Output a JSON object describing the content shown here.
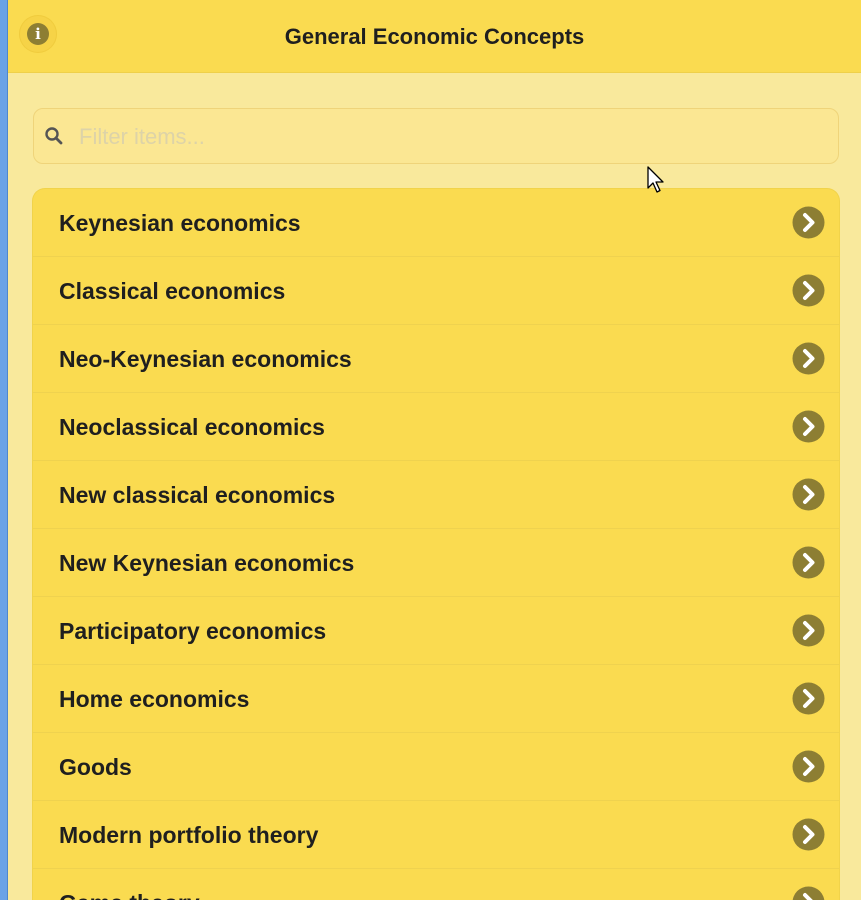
{
  "header": {
    "title": "General Economic Concepts",
    "info_icon": "info-icon",
    "info_glyph": "i"
  },
  "search": {
    "placeholder": "Filter items...",
    "value": "",
    "icon": "search-icon"
  },
  "items": [
    {
      "label": "Keynesian economics"
    },
    {
      "label": "Classical economics"
    },
    {
      "label": "Neo-Keynesian economics"
    },
    {
      "label": "Neoclassical economics"
    },
    {
      "label": "New classical economics"
    },
    {
      "label": "New Keynesian economics"
    },
    {
      "label": "Participatory economics"
    },
    {
      "label": "Home economics"
    },
    {
      "label": "Goods"
    },
    {
      "label": "Modern portfolio theory"
    },
    {
      "label": "Game theory"
    }
  ],
  "item_icon": "chevron-right-icon",
  "colors": {
    "header_bg": "#fadb50",
    "page_bg": "#f9e99c",
    "list_bg": "#fadb50",
    "icon_bg": "#8d7e33",
    "left_edge": "#6aa2e6"
  }
}
